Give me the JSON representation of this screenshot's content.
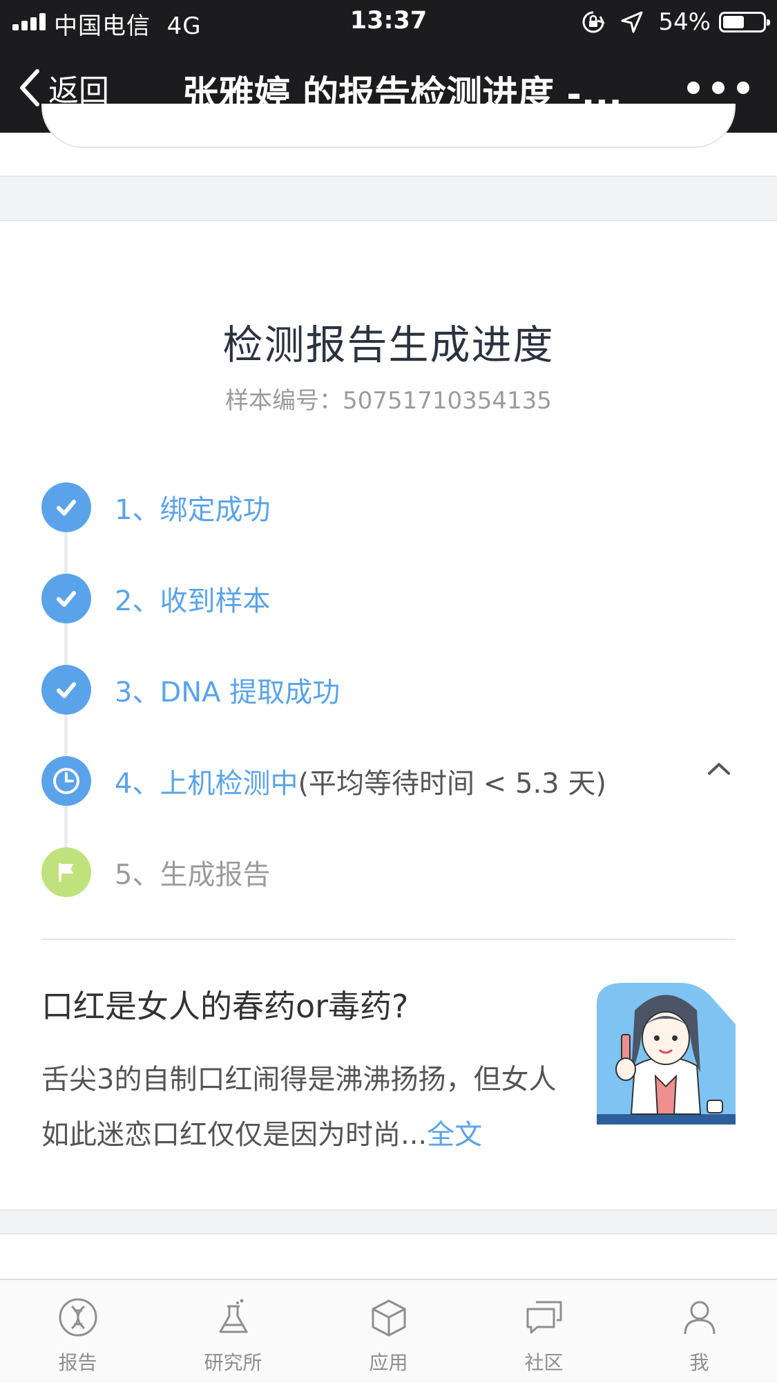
{
  "status_bar": {
    "carrier": "中国电信",
    "network": "4G",
    "time": "13:37",
    "battery_percent": "54%",
    "battery_level": 0.54
  },
  "nav": {
    "back_label": "返回",
    "title": "张雅婷 的报告检测进度 -..."
  },
  "progress": {
    "title": "检测报告生成进度",
    "sample_number": "样本编号：50751710354135",
    "steps": [
      {
        "label": "1、绑定成功",
        "state": "done",
        "icon": "check-icon"
      },
      {
        "label": "2、收到样本",
        "state": "done",
        "icon": "check-icon"
      },
      {
        "label": "3、DNA 提取成功",
        "state": "done",
        "icon": "check-icon"
      },
      {
        "label": "4、上机检测中",
        "extra": " (平均等待时间 < 5.3 天)",
        "state": "current",
        "icon": "clock-icon"
      },
      {
        "label": "5、生成报告",
        "state": "pending",
        "icon": "flag-icon"
      }
    ]
  },
  "article": {
    "title": "口红是女人的春药or毒药?",
    "summary": "舌尖3的自制口红闹得是沸沸扬扬，但女人如此迷恋口红仅仅是因为时尚...",
    "more_link": "全文"
  },
  "tabbar": {
    "items": [
      {
        "label": "报告",
        "icon": "dna-icon"
      },
      {
        "label": "研究所",
        "icon": "flask-icon"
      },
      {
        "label": "应用",
        "icon": "cube-icon"
      },
      {
        "label": "社区",
        "icon": "chat-icon"
      },
      {
        "label": "我",
        "icon": "person-icon"
      }
    ]
  },
  "colors": {
    "accent": "#5aa3ea",
    "flag": "#bfe27c",
    "nav_bg": "#1c1c1e"
  }
}
